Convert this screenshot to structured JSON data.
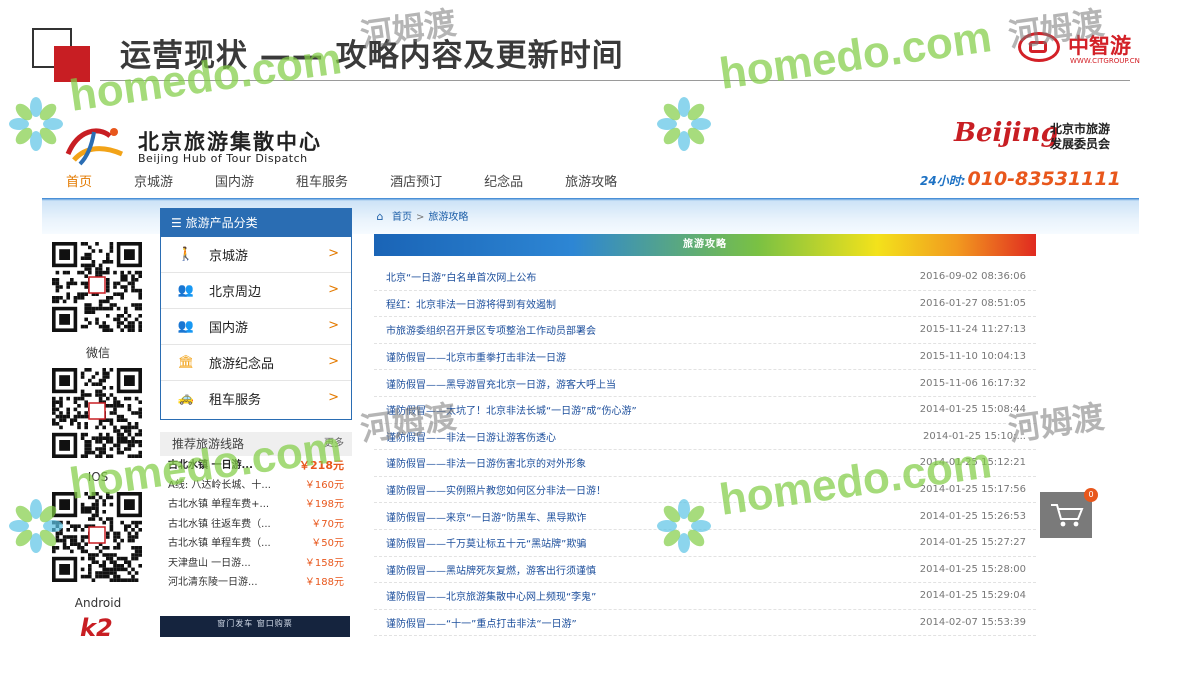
{
  "slide": {
    "title": "运营现状 —— 攻略内容及更新时间",
    "logo_name": "中智游",
    "logo_url": "WWW.CITGROUP.CN"
  },
  "site": {
    "logo_cn": "北京旅游集散中心",
    "logo_en": "Beijing Hub of Tour Dispatch",
    "bj_logo_mark": "Beijing",
    "bj_logo_text_1": "北京市旅游",
    "bj_logo_text_2": "发展委员会",
    "nav": [
      "首页",
      "京城游",
      "国内游",
      "租车服务",
      "酒店预订",
      "纪念品",
      "旅游攻略"
    ],
    "hotline_label": "24小时:",
    "hotline_number": "010-83531111"
  },
  "qr": {
    "labels": [
      "微信",
      "IOS",
      "Android"
    ]
  },
  "categories": {
    "header": "旅游产品分类",
    "items": [
      {
        "label": "京城游",
        "icon": "walker-icon"
      },
      {
        "label": "北京周边",
        "icon": "group-icon"
      },
      {
        "label": "国内游",
        "icon": "group-icon"
      },
      {
        "label": "旅游纪念品",
        "icon": "temple-icon"
      },
      {
        "label": "租车服务",
        "icon": "car-icon"
      }
    ]
  },
  "routes": {
    "header": "推荐旅游线路",
    "more": "更多",
    "items": [
      {
        "name": "古北水镇 一日游...",
        "price": "￥218元"
      },
      {
        "name": "A线: 八达岭长城、十...",
        "price": "￥160元"
      },
      {
        "name": "古北水镇 单程车费+...",
        "price": "￥198元"
      },
      {
        "name": "古北水镇 往返车费（...",
        "price": "￥70元"
      },
      {
        "name": "古北水镇 单程车费（...",
        "price": "￥50元"
      },
      {
        "name": "天津盘山 一日游...",
        "price": "￥158元"
      },
      {
        "name": "河北清东陵一日游...",
        "price": "￥188元"
      }
    ],
    "banner_text": "窗门发车 窗口购票"
  },
  "breadcrumb": {
    "home": "首页",
    "sep": ">",
    "current": "旅游攻略"
  },
  "banner": {
    "title": "旅游攻略"
  },
  "articles": [
    {
      "title": "北京“一日游”白名单首次网上公布",
      "time": "2016-09-02 08:36:06"
    },
    {
      "title": "程红：北京非法一日游将得到有效遏制",
      "time": "2016-01-27 08:51:05"
    },
    {
      "title": "市旅游委组织召开景区专项整治工作动员部署会",
      "time": "2015-11-24 11:27:13"
    },
    {
      "title": "谨防假冒——北京市重拳打击非法一日游",
      "time": "2015-11-10 10:04:13"
    },
    {
      "title": "谨防假冒——黑导游冒充北京一日游，游客大呼上当",
      "time": "2015-11-06 16:17:32"
    },
    {
      "title": "谨防假冒——太坑了！北京非法长城“一日游”成“伤心游”",
      "time": "2014-01-25 15:08:44"
    },
    {
      "title": "谨防假冒——非法一日游让游客伤透心",
      "time": "2014-01-25 15:10:..."
    },
    {
      "title": "谨防假冒——非法一日游伤害北京的对外形象",
      "time": "2014-01-25 15:12:21"
    },
    {
      "title": "谨防假冒——实例照片教您如何区分非法一日游！",
      "time": "2014-01-25 15:17:56"
    },
    {
      "title": "谨防假冒——来京“一日游”防黑车、黑导欺诈",
      "time": "2014-01-25 15:26:53"
    },
    {
      "title": "谨防假冒——千万莫让标五十元“黑站牌”欺骗",
      "time": "2014-01-25 15:27:27"
    },
    {
      "title": "谨防假冒——黑站牌死灰复燃，游客出行须谨慎",
      "time": "2014-01-25 15:28:00"
    },
    {
      "title": "谨防假冒——北京旅游集散中心网上频现“李鬼”",
      "time": "2014-01-25 15:29:04"
    },
    {
      "title": "谨防假冒——“十一”重点打击非法“一日游”",
      "time": "2014-02-07 15:53:39"
    }
  ],
  "cart": {
    "count": "0"
  },
  "watermark": {
    "latin": "homedo.com",
    "cn": "河姆渡"
  },
  "colors": {
    "brand_red": "#c81e23",
    "nav_active": "#e37a00",
    "panel_blue": "#2a6db3",
    "link_blue": "#1d4f9c",
    "price_orange": "#e8571c",
    "watermark_green": "#82cd46"
  }
}
